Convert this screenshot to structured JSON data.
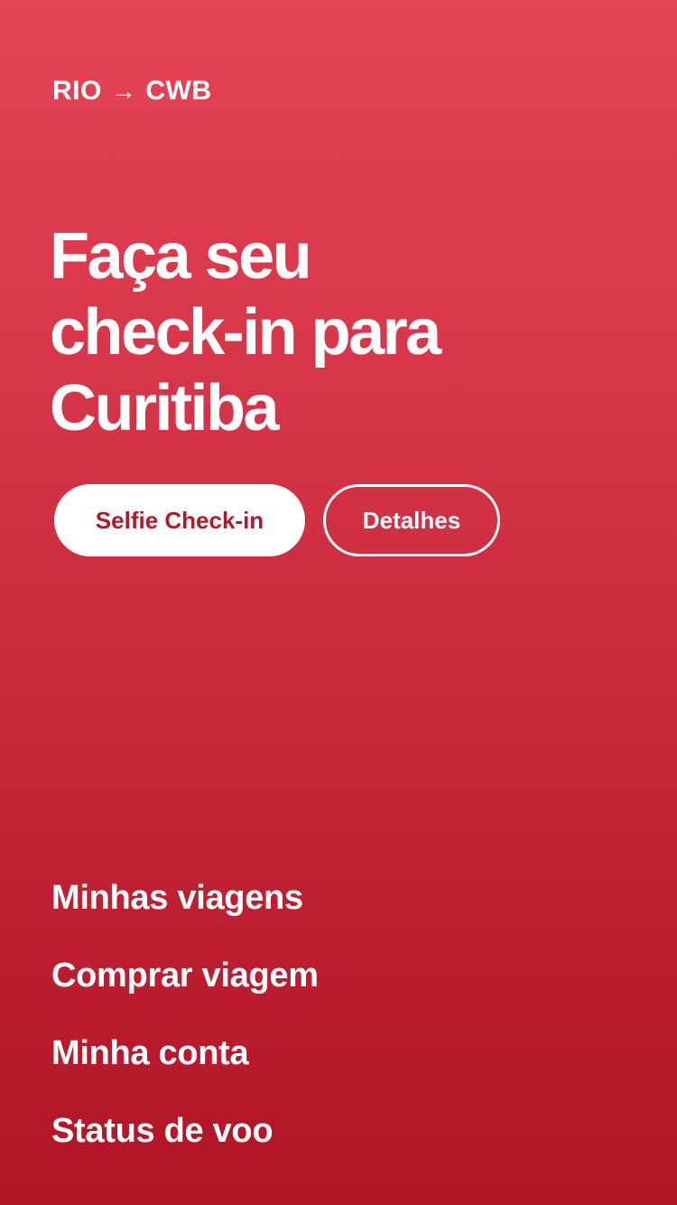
{
  "route": {
    "origin": "RIO",
    "arrow": "→",
    "destination": "CWB"
  },
  "headline": {
    "line1": "Faça seu",
    "line2": "check-in para",
    "line3": "Curitiba"
  },
  "actions": {
    "primary_label": "Selfie Check-in",
    "secondary_label": "Detalhes"
  },
  "menu": {
    "items": [
      {
        "label": "Minhas viagens"
      },
      {
        "label": "Comprar viagem"
      },
      {
        "label": "Minha conta"
      },
      {
        "label": "Status de voo"
      }
    ]
  },
  "colors": {
    "gradient_top": "#e64556",
    "gradient_bottom": "#b01425",
    "primary_button_text": "#b0192b",
    "text": "#ffffff"
  }
}
